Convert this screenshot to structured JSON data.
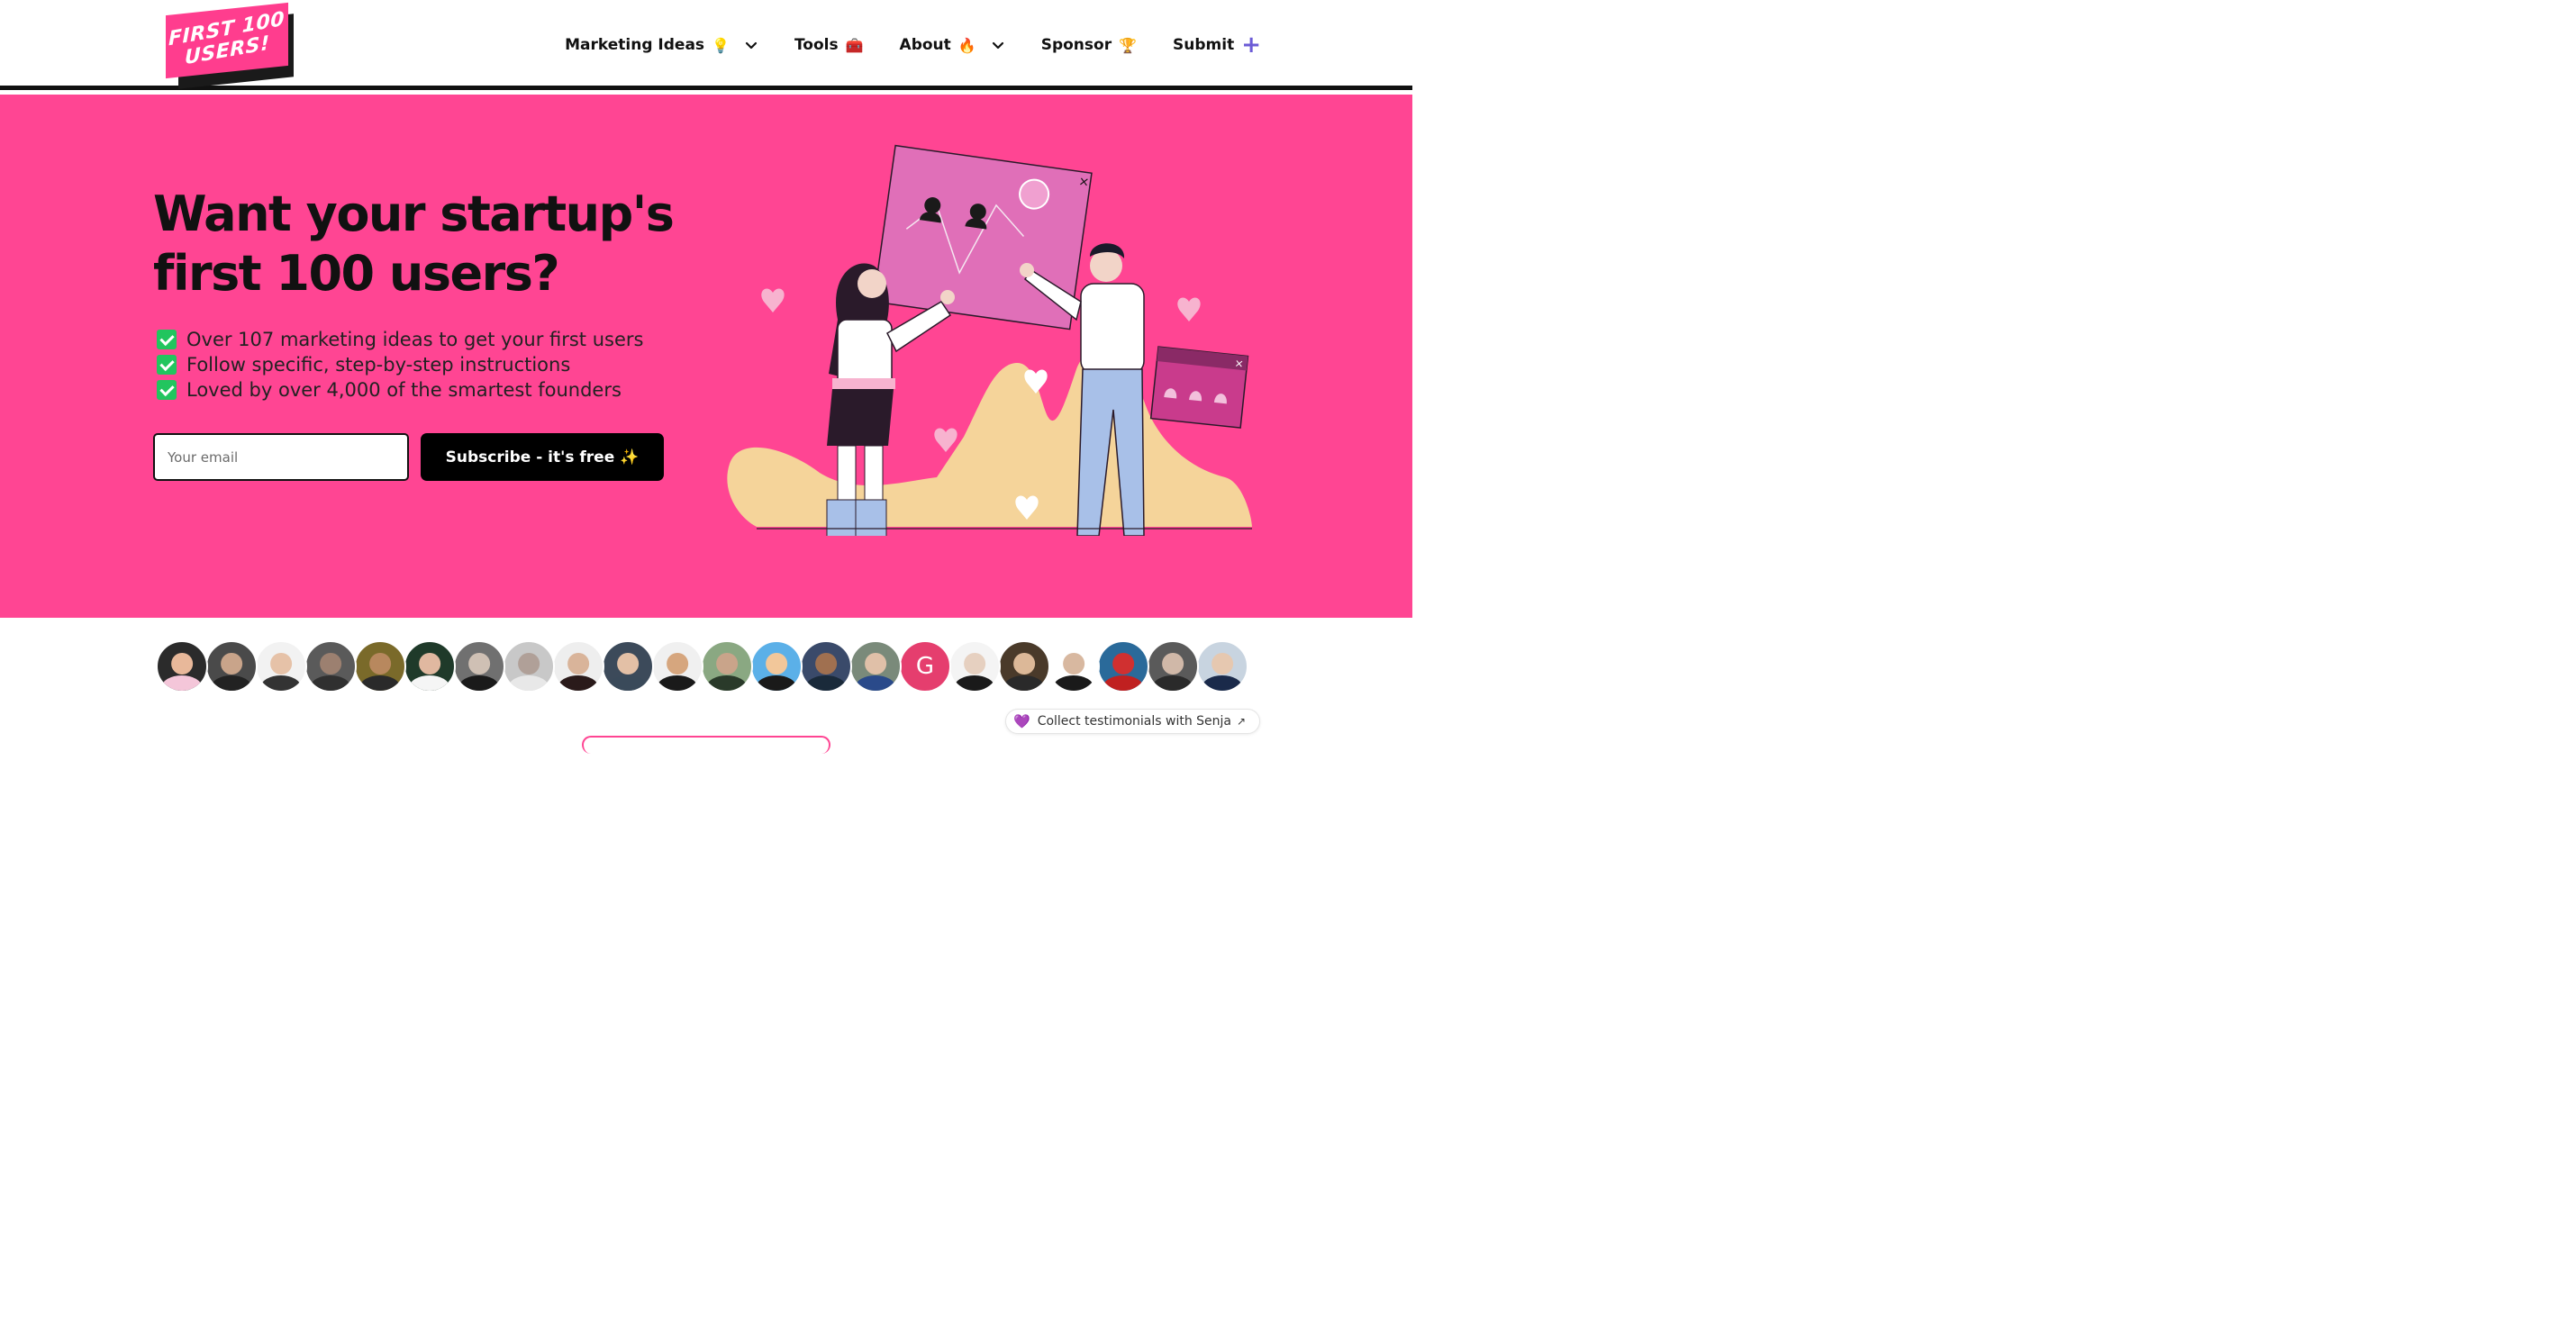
{
  "header": {
    "logo": {
      "line1": "FIRST 100",
      "line2": "USERS!"
    },
    "nav": [
      {
        "label": "Marketing Ideas",
        "emoji": "💡",
        "dropdown": true
      },
      {
        "label": "Tools",
        "emoji": "🧰",
        "dropdown": false
      },
      {
        "label": "About",
        "emoji": "🔥",
        "dropdown": true
      },
      {
        "label": "Sponsor",
        "emoji": "🏆",
        "dropdown": false
      },
      {
        "label": "Submit",
        "icon": "plus-icon",
        "dropdown": false
      }
    ]
  },
  "hero": {
    "headline": "Want your startup's first 100 users?",
    "bullets": [
      "Over 107 marketing ideas to get your first users",
      "Follow specific, step-by-step instructions",
      "Loved by over 4,000 of the smartest founders"
    ],
    "email_placeholder": "Your email",
    "subscribe_label": "Subscribe - it's free ✨"
  },
  "avatars": [
    {
      "bg": "#2b2b2b",
      "skin": "#e8b89a",
      "shirt": "#f4c6d9"
    },
    {
      "bg": "#4a4a4a",
      "skin": "#c9a48a",
      "shirt": "#222222"
    },
    {
      "bg": "#f2f2f2",
      "skin": "#e6c2a8",
      "shirt": "#333333"
    },
    {
      "bg": "#5a5a5a",
      "skin": "#9c8070",
      "shirt": "#303030"
    },
    {
      "bg": "#7a6a2a",
      "skin": "#b8885e",
      "shirt": "#2a2a2a"
    },
    {
      "bg": "#1f3a2a",
      "skin": "#e0b8a0",
      "shirt": "#f5f5f5"
    },
    {
      "bg": "#707070",
      "skin": "#cfc0b4",
      "shirt": "#1a1a1a"
    },
    {
      "bg": "#c8c8c8",
      "skin": "#b0a098",
      "shirt": "#e8e8e8"
    },
    {
      "bg": "#eeeeee",
      "skin": "#d9b49a",
      "shirt": "#2a1a1a"
    },
    {
      "bg": "#3c4a5a",
      "skin": "#e3c0a6",
      "shirt": "#3a4a5a"
    },
    {
      "bg": "#f0f0f0",
      "skin": "#d6a67e",
      "shirt": "#1a1a1a"
    },
    {
      "bg": "#8aa882",
      "skin": "#c9a48a",
      "shirt": "#2a3a2a"
    },
    {
      "bg": "#5bb0e8",
      "skin": "#f2c79a",
      "shirt": "#1a1a1a"
    },
    {
      "bg": "#3a4a6a",
      "skin": "#a07050",
      "shirt": "#1a2a3a"
    },
    {
      "bg": "#7a8a7a",
      "skin": "#e0c0a8",
      "shirt": "#2a4a8a"
    },
    {
      "bg": "#e53e6e",
      "letter": "G"
    },
    {
      "bg": "#f4f4f4",
      "skin": "#e6d0c0",
      "shirt": "#1a1a1a"
    },
    {
      "bg": "#4a3a2a",
      "skin": "#dcb898",
      "shirt": "#2a2a2a"
    },
    {
      "bg": "#ffffff",
      "skin": "#d8b8a0",
      "shirt": "#1a1a1a"
    },
    {
      "bg": "#2a6a9a",
      "skin": "#d03030",
      "shirt": "#c02020"
    },
    {
      "bg": "#5a5a5a",
      "skin": "#d0b8a8",
      "shirt": "#2a2a2a"
    },
    {
      "bg": "#c8d4e0",
      "skin": "#e6c8b0",
      "shirt": "#1a2a4a"
    }
  ],
  "senja": {
    "label": "Collect testimonials with Senja",
    "icon": "heart-icon"
  }
}
